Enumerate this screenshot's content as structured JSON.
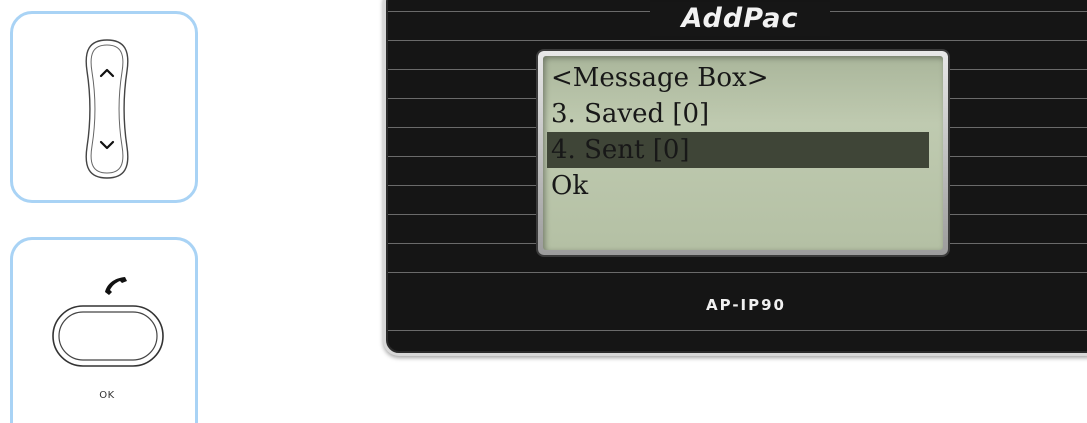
{
  "keypad": {
    "nav": {
      "up_icon": "chevron-up-icon",
      "down_icon": "chevron-down-icon"
    },
    "ok": {
      "call_icon": "handset-icon",
      "label": "OK"
    }
  },
  "phone": {
    "brand": "AddPac",
    "model": "AP-IP90",
    "lcd": {
      "lines": [
        "<Message Box>",
        "3. Saved [0]",
        "4. Sent [0]",
        "Ok"
      ],
      "selected_index": 2
    }
  },
  "colors": {
    "panel_border": "#a9d3f5",
    "lcd_background": "#bfcab0",
    "lcd_highlight": "#3f4537",
    "phone_body": "#151515"
  }
}
